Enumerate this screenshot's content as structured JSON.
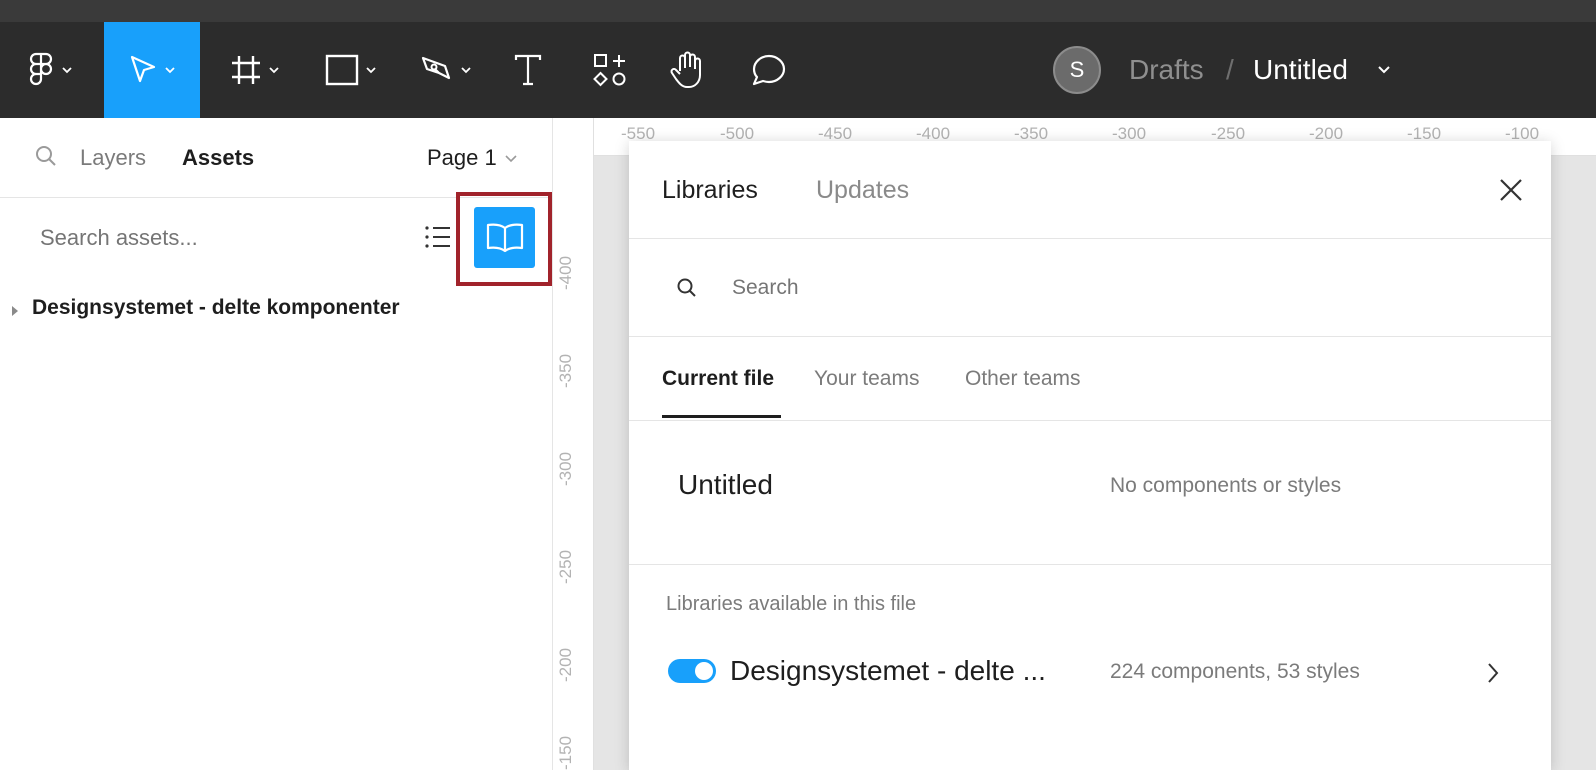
{
  "toolbar": {
    "tools": [
      {
        "name": "main-menu",
        "icon": "figma-logo-icon",
        "has_chevron": true
      },
      {
        "name": "move-tool",
        "icon": "move-cursor-icon",
        "has_chevron": true,
        "active": true
      },
      {
        "name": "frame-tool",
        "icon": "frame-icon",
        "has_chevron": true
      },
      {
        "name": "shape-tool",
        "icon": "rectangle-icon",
        "has_chevron": true
      },
      {
        "name": "pen-tool",
        "icon": "pen-icon",
        "has_chevron": true
      },
      {
        "name": "text-tool",
        "icon": "text-icon"
      },
      {
        "name": "resources-tool",
        "icon": "resources-icon"
      },
      {
        "name": "hand-tool",
        "icon": "hand-icon"
      },
      {
        "name": "comment-tool",
        "icon": "comment-icon"
      }
    ],
    "active_color": "#18a0fb",
    "avatar_initial": "S",
    "breadcrumb": {
      "parent": "Drafts",
      "separator": "/",
      "title": "Untitled"
    }
  },
  "left_panel": {
    "tabs": {
      "layers": "Layers",
      "assets": "Assets"
    },
    "page_selector": "Page 1",
    "asset_search_placeholder": "Search assets...",
    "tree": [
      {
        "label": "Designsystemet - delte komponenter"
      }
    ]
  },
  "rulers": {
    "top": [
      "-550",
      "-500",
      "-450",
      "-400",
      "-350",
      "-300",
      "-250",
      "-200",
      "-150",
      "-100"
    ],
    "left": [
      "-400",
      "-350",
      "-300",
      "-250",
      "-200",
      "-150"
    ]
  },
  "libraries_modal": {
    "tabs": {
      "libraries": "Libraries",
      "updates": "Updates"
    },
    "search_placeholder": "Search",
    "subtabs": {
      "current": "Current file",
      "your_teams": "Your teams",
      "other_teams": "Other teams"
    },
    "current_file": {
      "name": "Untitled",
      "meta": "No components or styles"
    },
    "available_heading": "Libraries available in this file",
    "libraries": [
      {
        "name": "Designsystemet - delte ...",
        "meta": "224 components, 53 styles",
        "enabled": true
      }
    ]
  }
}
